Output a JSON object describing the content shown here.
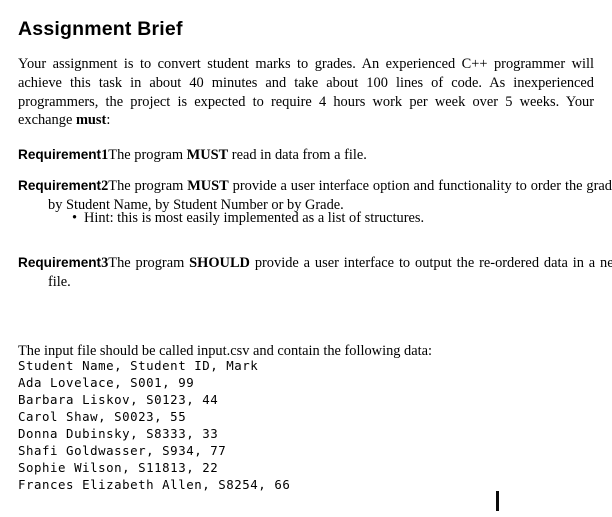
{
  "document": {
    "title": "Assignment Brief",
    "intro_paragraph": "Your assignment is to convert student marks to grades. An experienced C++ programmer will achieve this task in about 40 minutes and take about 100 lines of code. As inexperienced programmers, the project is expected to require 4 hours work per week over 5 weeks. Your exchange ",
    "intro_emphasis": "must",
    "intro_tail": ":",
    "requirements": [
      {
        "label": "Requirement",
        "number": "1",
        "text_before": "The program ",
        "emphasis": "MUST",
        "text_after": " read in data from a file."
      },
      {
        "label": "Requirement",
        "number": "2",
        "text_before": "The program ",
        "emphasis": "MUST",
        "text_after": " provide a user interface option and functionality to order the grades by Student Name, by Student Number or by Grade."
      },
      {
        "label": "Requirement",
        "number": "3",
        "text_before": "The program ",
        "emphasis": "SHOULD",
        "text_after": " provide a user interface to output the re-ordered data in a new file."
      }
    ],
    "hint": {
      "bullet_glyph": "•",
      "text": "Hint: this is most easily implemented as a list of structures."
    },
    "csv_intro": "The input file should be called input.csv and contain the following data:",
    "csv_filename": "input.csv",
    "csv": {
      "header": "Student Name, Student ID, Mark",
      "columns": [
        "Student Name",
        "Student ID",
        "Mark"
      ],
      "rows": [
        {
          "name": "Ada Lovelace",
          "id": "S001",
          "mark": "99",
          "line": "Ada Lovelace, S001, 99"
        },
        {
          "name": "Barbara Liskov",
          "id": "S0123",
          "mark": "44",
          "line": "Barbara Liskov, S0123, 44"
        },
        {
          "name": "Carol Shaw",
          "id": "S0023",
          "mark": "55",
          "line": "Carol Shaw, S0023, 55"
        },
        {
          "name": "Donna Dubinsky",
          "id": "S8333",
          "mark": "33",
          "line": "Donna Dubinsky, S8333, 33"
        },
        {
          "name": "Shafi Goldwasser",
          "id": "S934",
          "mark": "77",
          "line": "Shafi Goldwasser, S934, 77"
        },
        {
          "name": "Sophie Wilson",
          "id": "S11813",
          "mark": "22",
          "line": "Sophie Wilson, S11813, 22"
        },
        {
          "name": "Frances Elizabeth Allen",
          "id": "S8254",
          "mark": "66",
          "line": "Frances Elizabeth Allen, S8254, 66"
        }
      ]
    }
  },
  "colors": {
    "background": "#ffffff",
    "text": "#000000",
    "caret": "#0a0a0a"
  }
}
